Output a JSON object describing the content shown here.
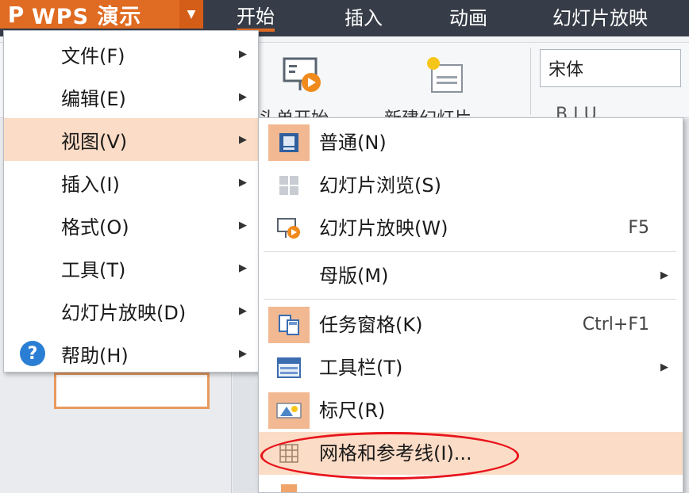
{
  "app": {
    "logo": "P",
    "title": "WPS 演示",
    "caret": "▼"
  },
  "tabs": [
    "开始",
    "插入",
    "动画",
    "幻灯片放映"
  ],
  "ribbon": {
    "btn1_label": "头单开始 -",
    "btn2_label": "新建幻灯片 -",
    "font_name": "宋体",
    "small_letters": "B   I   U"
  },
  "main_menu": [
    {
      "label": "文件(F)",
      "has_arrow": true
    },
    {
      "label": "编辑(E)",
      "has_arrow": true
    },
    {
      "label": "视图(V)",
      "has_arrow": true,
      "highlighted": true
    },
    {
      "label": "插入(I)",
      "has_arrow": true
    },
    {
      "label": "格式(O)",
      "has_arrow": true
    },
    {
      "label": "工具(T)",
      "has_arrow": true
    },
    {
      "label": "幻灯片放映(D)",
      "has_arrow": true
    },
    {
      "label": "帮助(H)",
      "has_arrow": true,
      "icon": "help-icon"
    }
  ],
  "view_submenu": [
    {
      "label": "普通(N)",
      "icon": "normal-view-icon",
      "checked": true
    },
    {
      "label": "幻灯片浏览(S)",
      "icon": "slide-sorter-icon"
    },
    {
      "label": "幻灯片放映(W)",
      "icon": "slideshow-icon",
      "shortcut": "F5"
    },
    {
      "label": "母版(M)",
      "has_arrow": true
    },
    {
      "label": "任务窗格(K)",
      "icon": "task-pane-icon",
      "shortcut": "Ctrl+F1",
      "checked": true
    },
    {
      "label": "工具栏(T)",
      "icon": "toolbar-icon",
      "has_arrow": true
    },
    {
      "label": "标尺(R)",
      "icon": "ruler-icon",
      "checked": true
    },
    {
      "label": "网格和参考线(I)...",
      "icon": "grid-icon",
      "highlighted": true
    }
  ],
  "colors": {
    "accent": "#e06b22",
    "highlight": "#fbdcc6",
    "annotation": "#e8141c"
  }
}
